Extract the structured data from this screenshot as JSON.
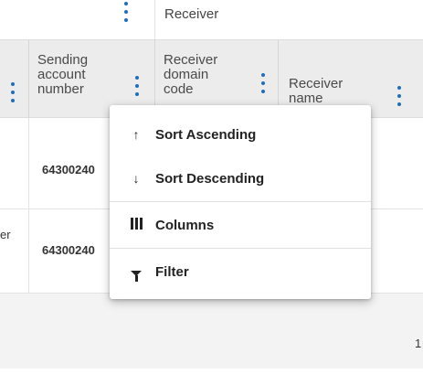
{
  "group_header": {
    "label": "Receiver"
  },
  "columns": [
    {
      "label": "Sending\naccount\nnumber"
    },
    {
      "label": "Receiver\ndomain\ncode"
    },
    {
      "label": "Receiver\nname"
    }
  ],
  "rows": [
    {
      "partial_left": "",
      "sending_account_number": "64300240"
    },
    {
      "partial_left": "er",
      "sending_account_number": "64300240"
    }
  ],
  "context_menu": {
    "items": [
      {
        "icon": "arrow-up-icon",
        "glyph": "↑",
        "label": "Sort Ascending"
      },
      {
        "icon": "arrow-down-icon",
        "glyph": "↓",
        "label": "Sort Descending"
      },
      {
        "icon": "columns-icon",
        "label": "Columns"
      },
      {
        "icon": "filter-icon",
        "label": "Filter"
      }
    ]
  },
  "pagination": {
    "page": "1"
  },
  "colors": {
    "accent": "#1e6fb8",
    "header_bg": "#ececec"
  }
}
